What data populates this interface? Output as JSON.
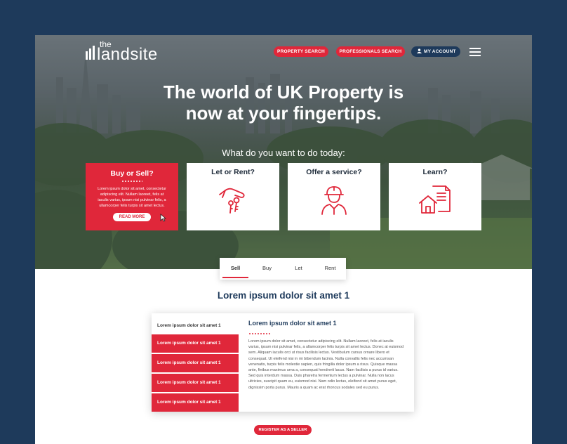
{
  "logo": {
    "small": "the",
    "main": "landsite"
  },
  "nav": {
    "property_search": "PROPERTY SEARCH",
    "professionals_search": "PROFESSIONALS SEARCH",
    "my_account": "MY ACCOUNT",
    "menu_icon": "hamburger-menu-icon",
    "account_icon": "user-icon"
  },
  "hero": {
    "headline_line1": "The world of UK Property is",
    "headline_line2": "now at your fingertips.",
    "question": "What do you want to do today:"
  },
  "cards": [
    {
      "title": "Buy or Sell?",
      "body": "Lorem ipsum dolor sit amet, consectetur adipiscing elit. Nullam laoreet, felis at iaculis varius, ipsum nisi pulvinar felis, a ullamcorper felis turpis sit amet lectus.",
      "button": "READ MORE"
    },
    {
      "title": "Let or Rent?",
      "icon": "hand-keys-icon"
    },
    {
      "title": "Offer a service?",
      "icon": "worker-hardhat-icon"
    },
    {
      "title": "Learn?",
      "icon": "house-document-icon"
    }
  ],
  "tabs": [
    "Sell",
    "Buy",
    "Let",
    "Rent"
  ],
  "section": {
    "title": "Lorem ipsum dolor sit amet 1"
  },
  "panel": {
    "side_header": "Lorem ipsum dolor sit amet 1",
    "side_items": [
      "Lorem ipsum dolor sit amet 1",
      "Lorem ipsum dolor sit amet 1",
      "Lorem ipsum dolor sit amet 1",
      "Lorem ipsum dolor sit amet 1"
    ],
    "title": "Lorem ipsum dolor sit amet 1",
    "body": "Lorem ipsum dolor sit amet, consectetur adipiscing elit. Nullam laoreet, felis at iaculis varius, ipsum nisi pulvinar felis, a ullamcorper felis turpis sit amet lectus. Donec at euismod sem. Aliquam iaculis orci ut risus facilisis lectus. Vestibulum cursus ornare libero et consequat. Ut eleifend nisi in mi bibendum lacinia. Nulla convallis felis nec accumsan venenatis, turpis felis molestie sapien, quis fringilla dolor ipsum a risus. Quisque massa ante, finibus maximus urna a, consequat hendrerit lacus. Nam facilisis a purus id varius. Sed quis interdum massa. Duis pharetra fermentum lectus a pulvinar. Nulla non lacus ultricies, suscipit quam eu, euismod nisi. Nam odio lectus, eleifend sit amet purus eget, dignissim porta purus. Mauris a quam ac erat rhoncus sodales sed eu purus."
  },
  "register_button": "REGISTER AS A SELLER",
  "colors": {
    "accent_red": "#e0273a",
    "navy": "#1e3a5b"
  }
}
